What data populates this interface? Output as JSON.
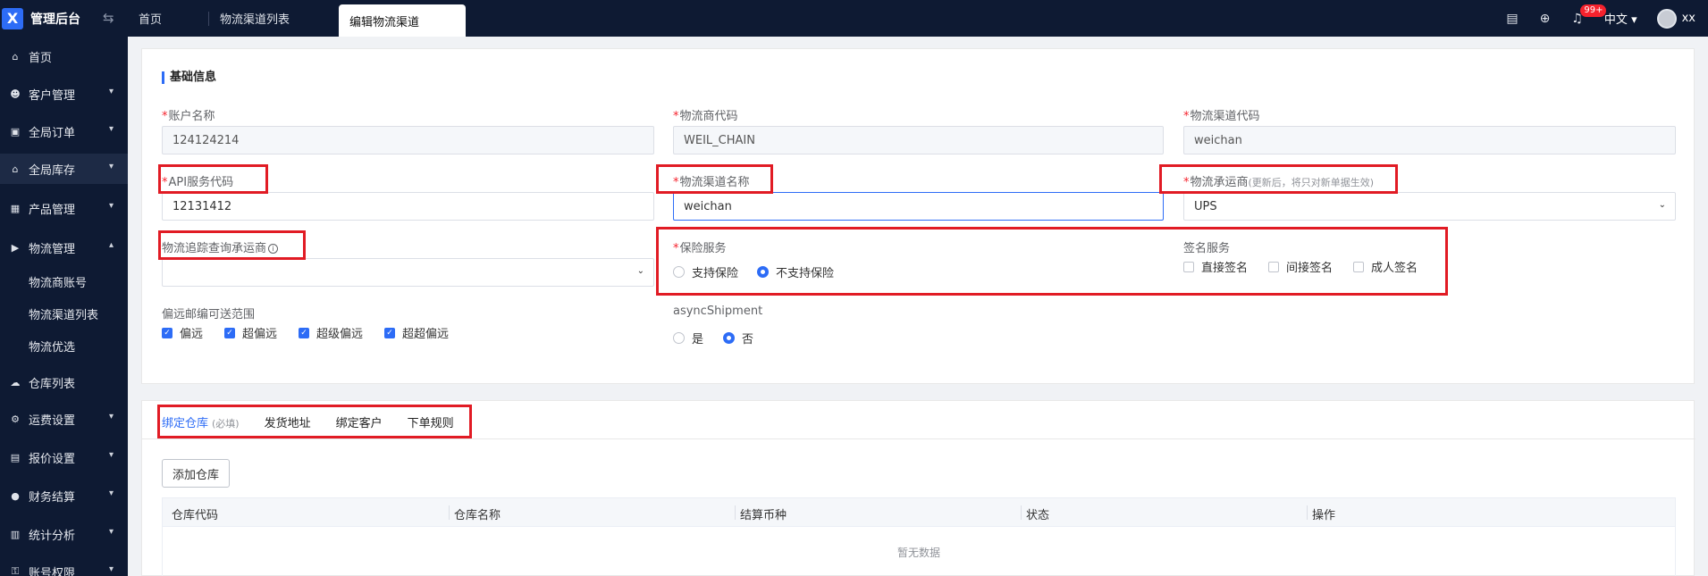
{
  "app": {
    "logo_mark": "X",
    "title": "管理后台",
    "collapse_icon": "swap-arrows-icon"
  },
  "tabs": [
    {
      "label": "首页"
    },
    {
      "label": "物流渠道列表"
    },
    {
      "label": "编辑物流渠道"
    }
  ],
  "header": {
    "bell_badge": "99+",
    "language": "中文",
    "username": "xx"
  },
  "sidebar": {
    "items": [
      {
        "label": "首页",
        "icon": "home-icon"
      },
      {
        "label": "客户管理",
        "icon": "users-icon"
      },
      {
        "label": "全局订单",
        "icon": "order-icon"
      },
      {
        "label": "全局库存",
        "icon": "warehouse-icon"
      },
      {
        "label": "产品管理",
        "icon": "box-icon"
      },
      {
        "label": "物流管理",
        "icon": "truck-icon"
      },
      {
        "label": "仓库列表",
        "icon": "cloud-icon"
      },
      {
        "label": "运费设置",
        "icon": "gear-icon"
      },
      {
        "label": "报价设置",
        "icon": "doc-icon"
      },
      {
        "label": "财务结算",
        "icon": "money-icon"
      },
      {
        "label": "统计分析",
        "icon": "chart-icon"
      },
      {
        "label": "账号权限",
        "icon": "key-icon"
      }
    ],
    "sub_items": [
      {
        "label": "物流商账号"
      },
      {
        "label": "物流渠道列表"
      },
      {
        "label": "物流优选"
      }
    ]
  },
  "form": {
    "section_title": "基础信息",
    "account_name": {
      "label": "账户名称",
      "value": "124124214"
    },
    "carrier_code": {
      "label": "物流商代码",
      "value": "WEIL_CHAIN"
    },
    "channel_code": {
      "label": "物流渠道代码",
      "value": "weichan"
    },
    "api_code": {
      "label": "API服务代码",
      "value": "12131412"
    },
    "channel_name": {
      "label": "物流渠道名称",
      "value": "weichan"
    },
    "channel_carrier": {
      "label": "物流承运商",
      "hint": "(更新后，将只对新单据生效)",
      "value": "UPS"
    },
    "tracking_carrier": {
      "label": "物流追踪查询承运商",
      "value": ""
    },
    "insurance": {
      "label": "保险服务",
      "options": [
        "支持保险",
        "不支持保险"
      ],
      "selected": "不支持保险"
    },
    "signature": {
      "label": "签名服务",
      "options": [
        "直接签名",
        "间接签名",
        "成人签名"
      ]
    },
    "remote_range": {
      "label": "偏远邮编可送范围",
      "options": [
        "偏远",
        "超偏远",
        "超级偏远",
        "超超偏远"
      ]
    },
    "async_shipment": {
      "label": "asyncShipment",
      "options": [
        "是",
        "否"
      ],
      "selected": "否"
    }
  },
  "bottom": {
    "tabs": [
      {
        "label": "绑定仓库",
        "hint": "(必填)"
      },
      {
        "label": "发货地址"
      },
      {
        "label": "绑定客户"
      },
      {
        "label": "下单规则"
      }
    ],
    "add_button": "添加仓库",
    "columns": [
      "仓库代码",
      "仓库名称",
      "结算币种",
      "状态",
      "操作"
    ],
    "empty_text": "暂无数据"
  },
  "colors": {
    "brand": "#2d6cf6",
    "sidebar_bg": "#0e1a33",
    "highlight": "#e11b24"
  }
}
